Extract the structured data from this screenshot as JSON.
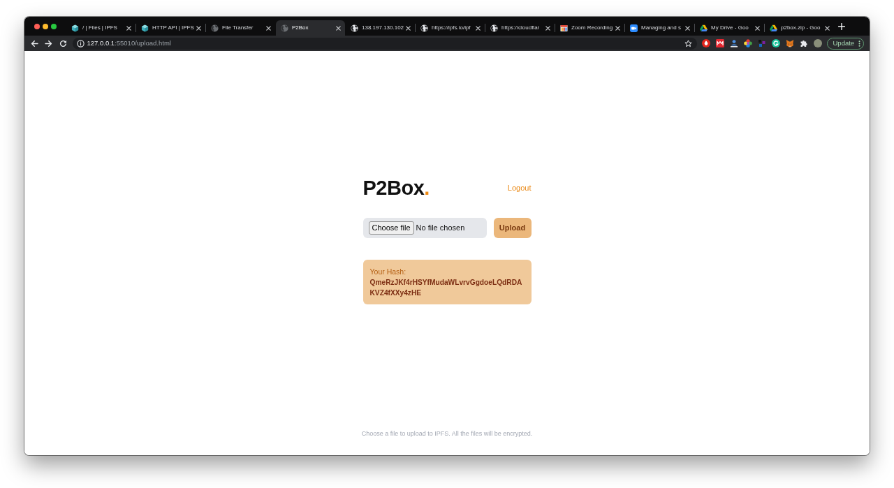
{
  "browser": {
    "tabs": [
      {
        "title": "/ | Files | IPFS",
        "kind": "cube",
        "selected": false
      },
      {
        "title": "HTTP API | IPFS",
        "kind": "cube",
        "selected": false
      },
      {
        "title": "File Transfer",
        "kind": "globe-dim",
        "selected": false
      },
      {
        "title": "P2Box",
        "kind": "globe-dim",
        "selected": true
      },
      {
        "title": "138.197.130.102",
        "kind": "globe",
        "selected": false
      },
      {
        "title": "https://ipfs.io/ipf",
        "kind": "globe",
        "selected": false
      },
      {
        "title": "https://cloudflar",
        "kind": "globe",
        "selected": false
      },
      {
        "title": "Zoom Recording",
        "kind": "box",
        "selected": false
      },
      {
        "title": "Managing and s",
        "kind": "camera",
        "selected": false
      },
      {
        "title": "My Drive - Goo",
        "kind": "triangle",
        "selected": false
      },
      {
        "title": "p2box.zip - Goo",
        "kind": "triangle",
        "selected": false
      }
    ],
    "address_bar": {
      "host": "127.0.0.1",
      "path": ":55010/upload.html"
    },
    "update_button": "Update"
  },
  "page": {
    "logo": {
      "text": "P2Box",
      "accent": "."
    },
    "logout_link": "Logout",
    "file_input": {
      "button": "Choose file",
      "status": "No file chosen"
    },
    "upload_button": "Upload",
    "hash_card": {
      "label": "Your Hash:",
      "hash": "QmeRzJKf4rHSYfMudaWLvrvGgdoeLQdRDAKVZ4fXXy4zHE"
    },
    "footer": "Choose a file to upload to IPFS. All the files will be encrypted."
  }
}
